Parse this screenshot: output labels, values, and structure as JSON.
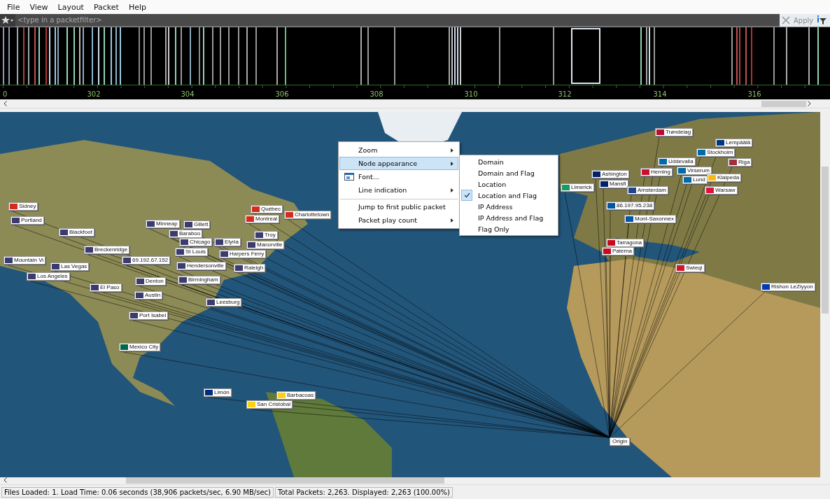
{
  "menu_bar": [
    "File",
    "View",
    "Layout",
    "Packet",
    "Help"
  ],
  "filter_bar": {
    "placeholder": "<type in a packetfilter>",
    "apply": "Apply"
  },
  "timeline": {
    "ticks": [
      "0",
      "302",
      "304",
      "306",
      "308",
      "310",
      "312",
      "314",
      "316"
    ]
  },
  "map": {
    "nodes": [
      {
        "label": "Trøndelag",
        "color": "#ba0c2f"
      },
      {
        "label": "Lempäälä",
        "color": "#003580"
      },
      {
        "label": "Stockholm",
        "color": "#006aa7"
      },
      {
        "label": "Uddevalla",
        "color": "#006aa7"
      },
      {
        "label": "Riga",
        "color": "#9e3039"
      },
      {
        "label": "Ashington",
        "color": "#012169"
      },
      {
        "label": "Herning",
        "color": "#c8102e"
      },
      {
        "label": "Virserum",
        "color": "#006aa7"
      },
      {
        "label": "Lund",
        "color": "#006aa7"
      },
      {
        "label": "Klaipeda",
        "color": "#fdb913"
      },
      {
        "label": "Limerick",
        "color": "#169b62"
      },
      {
        "label": "Mansfi",
        "color": "#012169"
      },
      {
        "label": "Amsterdam",
        "color": "#21468b"
      },
      {
        "label": "Warsaw",
        "color": "#dc143c"
      },
      {
        "label": "Sidney",
        "color": "#d52b1e"
      },
      {
        "label": "86.197.95.238",
        "color": "#0055a4"
      },
      {
        "label": "Québec",
        "color": "#d52b1e"
      },
      {
        "label": "Charlottetown",
        "color": "#d52b1e"
      },
      {
        "label": "Portland",
        "color": "#3c3b6e"
      },
      {
        "label": "Montreal",
        "color": "#d52b1e"
      },
      {
        "label": "Mont-Saxonnex",
        "color": "#0055a4"
      },
      {
        "label": "Minneap",
        "color": "#3c3b6e"
      },
      {
        "label": "Gillett",
        "color": "#3c3b6e"
      },
      {
        "label": "Blackfoot",
        "color": "#3c3b6e"
      },
      {
        "label": "Baraboo",
        "color": "#3c3b6e"
      },
      {
        "label": "Troy",
        "color": "#3c3b6e"
      },
      {
        "label": "Chicago",
        "color": "#3c3b6e"
      },
      {
        "label": "Elyria",
        "color": "#3c3b6e"
      },
      {
        "label": "Manorville",
        "color": "#3c3b6e"
      },
      {
        "label": "Tarragona",
        "color": "#c60b1e"
      },
      {
        "label": "Breckenridge",
        "color": "#3c3b6e"
      },
      {
        "label": "St Louis",
        "color": "#3c3b6e"
      },
      {
        "label": "Harpers Ferry",
        "color": "#3c3b6e"
      },
      {
        "label": "Paterna",
        "color": "#c60b1e"
      },
      {
        "label": "Mountain Vi",
        "color": "#3c3b6e"
      },
      {
        "label": "69.192.67.152",
        "color": "#3c3b6e"
      },
      {
        "label": "Las Vegas",
        "color": "#3c3b6e"
      },
      {
        "label": "Hendersonville",
        "color": "#3c3b6e"
      },
      {
        "label": "Raleigh",
        "color": "#3c3b6e"
      },
      {
        "label": "Swieqi",
        "color": "#cf142b"
      },
      {
        "label": "Los Angeles",
        "color": "#3c3b6e"
      },
      {
        "label": "Birmingham",
        "color": "#3c3b6e"
      },
      {
        "label": "Denton",
        "color": "#3c3b6e"
      },
      {
        "label": "El Paso",
        "color": "#3c3b6e"
      },
      {
        "label": "Rishon LeZiyyon",
        "color": "#0038b8"
      },
      {
        "label": "Austin",
        "color": "#3c3b6e"
      },
      {
        "label": "Leesburg",
        "color": "#3c3b6e"
      },
      {
        "label": "Port Isabel",
        "color": "#3c3b6e"
      },
      {
        "label": "Mexico City",
        "color": "#006847"
      },
      {
        "label": "Limón",
        "color": "#002b7f"
      },
      {
        "label": "Barbacoas",
        "color": "#fcd116"
      },
      {
        "label": "San Cristóbal",
        "color": "#fcd116"
      }
    ],
    "origin": "Origin"
  },
  "context_menu": {
    "items": [
      {
        "label": "Zoom",
        "submenu": true,
        "highlighted": false,
        "has_icon": false,
        "separator_before": false
      },
      {
        "label": "Node appearance",
        "submenu": true,
        "highlighted": true,
        "has_icon": false,
        "separator_before": false
      },
      {
        "label": "Font...",
        "submenu": false,
        "highlighted": false,
        "has_icon": true,
        "separator_before": false
      },
      {
        "label": "Line indication",
        "submenu": true,
        "highlighted": false,
        "has_icon": false,
        "separator_before": false
      },
      {
        "label": "Jump to first public packet",
        "submenu": false,
        "highlighted": false,
        "has_icon": false,
        "separator_before": true
      },
      {
        "label": "Packet play count",
        "submenu": true,
        "highlighted": false,
        "has_icon": false,
        "separator_before": false
      }
    ],
    "submenu": [
      {
        "label": "Domain",
        "checked": false
      },
      {
        "label": "Domain and Flag",
        "checked": false
      },
      {
        "label": "Location",
        "checked": false
      },
      {
        "label": "Location and Flag",
        "checked": true
      },
      {
        "label": "IP Address",
        "checked": false
      },
      {
        "label": "IP Address and Flag",
        "checked": false
      },
      {
        "label": "Flag Only",
        "checked": false
      }
    ]
  },
  "status_bar": [
    "Files Loaded: 1. Load Time: 0.06 seconds (38,906 packets/sec, 6.90 MB/sec)",
    "Total Packets: 2,263. Displayed: 2,263 (100.00%)"
  ]
}
